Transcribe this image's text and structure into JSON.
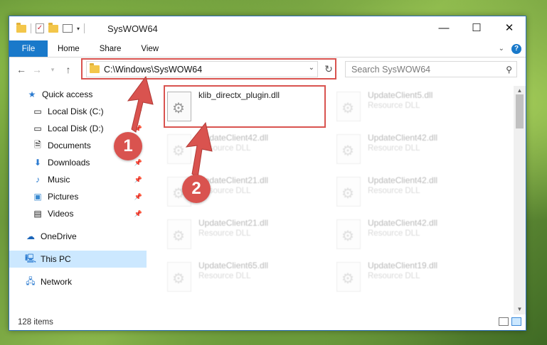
{
  "window": {
    "title": "SysWOW64"
  },
  "ribbon": {
    "tabs": [
      "File",
      "Home",
      "Share",
      "View"
    ],
    "help": "?"
  },
  "address": {
    "path": "C:\\Windows\\SysWOW64"
  },
  "search": {
    "placeholder": "Search SysWOW64"
  },
  "sidebar": {
    "items": [
      {
        "label": "Quick access",
        "icon": "star-icon"
      },
      {
        "label": "Local Disk (C:)",
        "icon": "drive-icon",
        "pinned": true
      },
      {
        "label": "Local Disk (D:)",
        "icon": "drive-icon",
        "pinned": true
      },
      {
        "label": "Documents",
        "icon": "documents-icon",
        "pinned": true
      },
      {
        "label": "Downloads",
        "icon": "downloads-icon",
        "pinned": true
      },
      {
        "label": "Music",
        "icon": "music-icon",
        "pinned": true
      },
      {
        "label": "Pictures",
        "icon": "pictures-icon",
        "pinned": true
      },
      {
        "label": "Videos",
        "icon": "videos-icon",
        "pinned": true
      },
      {
        "label": "OneDrive",
        "icon": "onedrive-icon"
      },
      {
        "label": "This PC",
        "icon": "pc-icon",
        "selected": true
      },
      {
        "label": "Network",
        "icon": "network-icon"
      }
    ]
  },
  "files": [
    {
      "name": "klib_directx_plugin.dll",
      "type": ""
    },
    {
      "name": "UpdateClient5.dll",
      "type": "Resource DLL"
    },
    {
      "name": "UpdateClient42.dll",
      "type": "Resource DLL"
    },
    {
      "name": "UpdateClient42.dll",
      "type": "Resource DLL"
    },
    {
      "name": "UpdateClient21.dll",
      "type": "Resource DLL"
    },
    {
      "name": "UpdateClient42.dll",
      "type": "Resource DLL"
    },
    {
      "name": "UpdateClient21.dll",
      "type": "Resource DLL"
    },
    {
      "name": "UpdateClient42.dll",
      "type": "Resource DLL"
    },
    {
      "name": "UpdateClient65.dll",
      "type": "Resource DLL"
    },
    {
      "name": "UpdateClient19.dll",
      "type": "Resource DLL"
    }
  ],
  "status": {
    "item_count": "128 items"
  },
  "callouts": {
    "one": "1",
    "two": "2"
  },
  "colors": {
    "accent": "#1979ca",
    "highlight": "#d9534f",
    "selected": "#cce8ff"
  }
}
